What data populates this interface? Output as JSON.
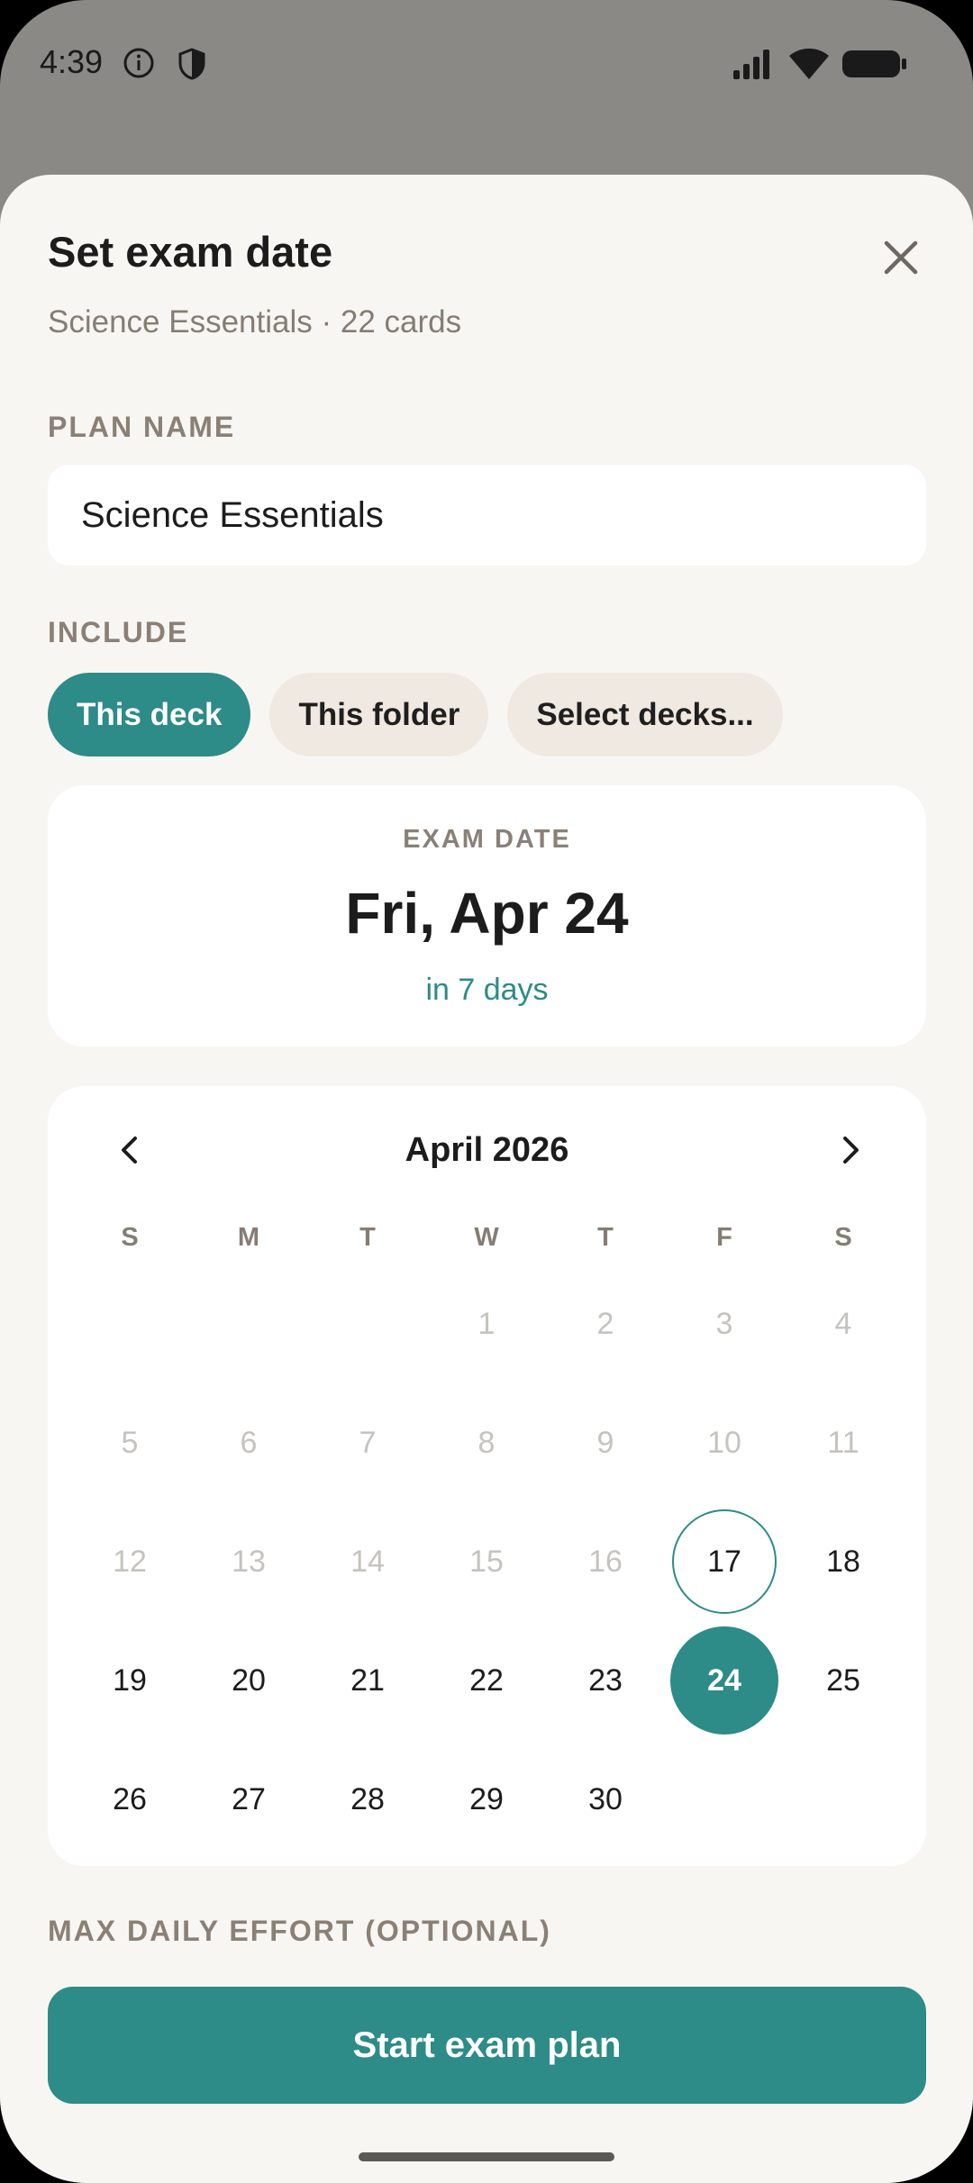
{
  "status_bar": {
    "time": "4:39"
  },
  "sheet": {
    "title": "Set exam date",
    "subtitle": "Science Essentials · 22 cards",
    "plan_name_label": "PLAN NAME",
    "plan_name_value": "Science Essentials",
    "include_label": "INCLUDE",
    "include_options": [
      {
        "label": "This deck",
        "selected": true
      },
      {
        "label": "This folder",
        "selected": false
      },
      {
        "label": "Select decks...",
        "selected": false
      }
    ],
    "exam_card": {
      "label": "EXAM DATE",
      "date": "Fri, Apr 24",
      "relative": "in 7 days"
    },
    "calendar": {
      "month": "April 2026",
      "weekdays": [
        "S",
        "M",
        "T",
        "W",
        "T",
        "F",
        "S"
      ],
      "leading_blanks": 3,
      "days": 30,
      "today": 17,
      "selected": 24
    },
    "effort_label": "MAX DAILY EFFORT (OPTIONAL)",
    "primary_button": "Start exam plan"
  },
  "colors": {
    "accent": "#2d8b88",
    "sheet_bg": "#f8f6f2",
    "chip_bg": "#efe9e1",
    "muted_text": "#857d74",
    "past_day": "#c6c3bf"
  }
}
